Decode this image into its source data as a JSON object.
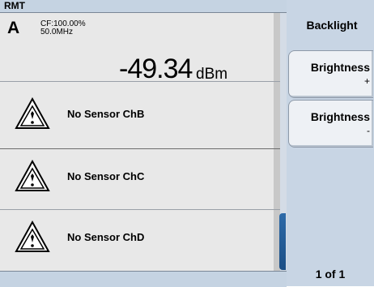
{
  "header": {
    "rmt_label": "RMT"
  },
  "channel_a": {
    "channel": "A",
    "cf": "CF:100.00%",
    "frequency": "50.0MHz",
    "value": "-49.34",
    "unit": "dBm"
  },
  "warnings": [
    {
      "text": "No Sensor ChB"
    },
    {
      "text": "No Sensor ChC"
    },
    {
      "text": "No Sensor ChD"
    }
  ],
  "menu": {
    "title": "Backlight",
    "keys": [
      {
        "label": "Brightness",
        "sub": "+"
      },
      {
        "label": "Brightness",
        "sub": "-"
      }
    ],
    "page": "1 of 1"
  },
  "colors": {
    "panel": "#e8e8e8",
    "header": "#c5d3e2",
    "softkey_area": "#c8d5e4",
    "accent": "#1c4f86"
  }
}
